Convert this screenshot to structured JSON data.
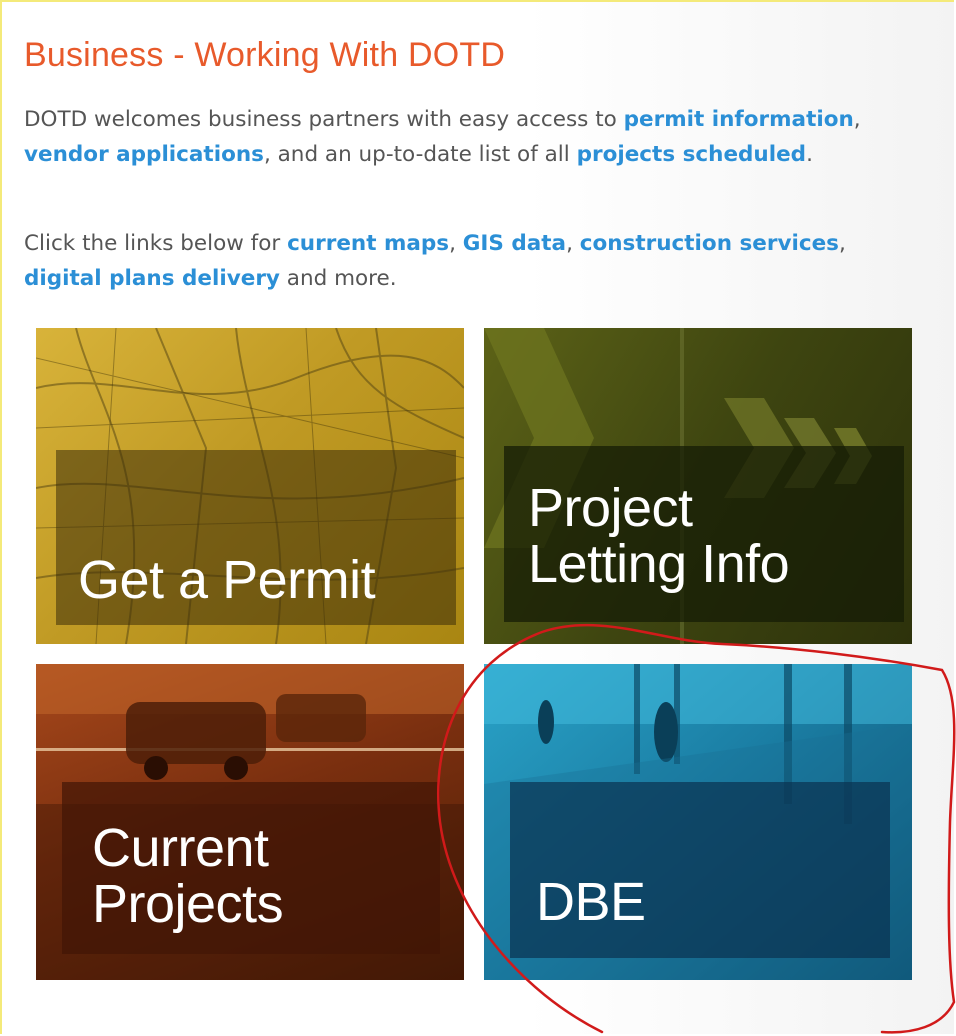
{
  "header": {
    "title": "Business - Working With DOTD"
  },
  "intro": {
    "p1_before": "DOTD welcomes business partners with easy access to ",
    "link_permit_information": "permit information",
    "p1_mid1": ", ",
    "link_vendor_applications": "vendor applications",
    "p1_mid2": ", and an up-to-date list of all ",
    "link_projects_scheduled": "projects scheduled",
    "p1_end": "."
  },
  "links_para": {
    "p2_before": "Click the links below for ",
    "link_current_maps": "current maps",
    "p2_sep1": ", ",
    "link_gis_data": "GIS data",
    "p2_sep2": ", ",
    "link_construction_services": "construction services",
    "p2_sep3": ", ",
    "link_digital_plans_delivery": "digital plans delivery",
    "p2_end": " and more."
  },
  "tiles": [
    {
      "label": "Get a Permit"
    },
    {
      "label": "Project\nLetting Info"
    },
    {
      "label": "Current\nProjects"
    },
    {
      "label": "DBE"
    }
  ],
  "colors": {
    "title": "#e85a2b",
    "link": "#2b8fd6",
    "text": "#555555",
    "annotation": "#d11a1a"
  }
}
